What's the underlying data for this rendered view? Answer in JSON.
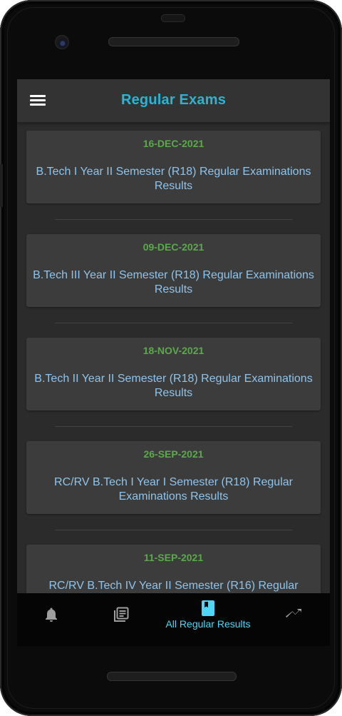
{
  "app_bar": {
    "title": "Regular Exams",
    "menu_icon": "hamburger-menu-icon"
  },
  "results": [
    {
      "date": "16-DEC-2021",
      "title": "B.Tech I Year II Semester (R18) Regular Examinations Results"
    },
    {
      "date": "09-DEC-2021",
      "title": "B.Tech III Year II Semester (R18) Regular Examinations Results"
    },
    {
      "date": "18-NOV-2021",
      "title": "B.Tech II Year II Semester (R18) Regular Examinations Results"
    },
    {
      "date": "26-SEP-2021",
      "title": "RC/RV B.Tech I Year I Semester (R18) Regular Examinations Results"
    },
    {
      "date": "11-SEP-2021",
      "title": "RC/RV B.Tech IV Year II Semester (R16) Regular"
    }
  ],
  "bottom_nav": {
    "items": [
      {
        "icon": "bell-icon",
        "label": ""
      },
      {
        "icon": "library-books-icon",
        "label": ""
      },
      {
        "icon": "book-icon",
        "label": "All Regular Results",
        "active": true
      },
      {
        "icon": "trending-up-icon",
        "label": ""
      }
    ]
  },
  "colors": {
    "accent": "#29b6d6",
    "date_green": "#5aaa4a",
    "title_blue": "#8ec4ec",
    "nav_active": "#4fd6f4",
    "card_bg": "#3c3c3c",
    "screen_bg": "#2b2b2b"
  }
}
